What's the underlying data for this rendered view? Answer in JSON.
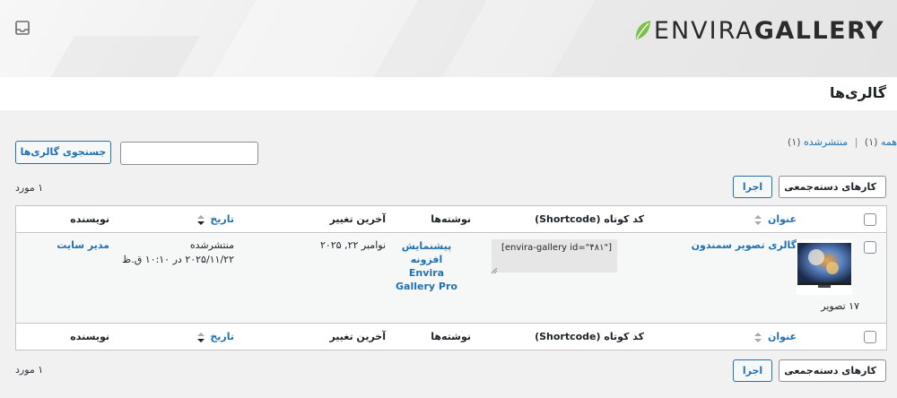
{
  "brand": {
    "name_light": "ENVIRA",
    "name_bold": "GALLERY",
    "accent": "#7cc048"
  },
  "page": {
    "title": "گالری‌ها"
  },
  "filters": {
    "all_label": "همه",
    "all_count": "(۱)",
    "separator": "|",
    "published_label": "منتشرشده",
    "published_count": "(۱)"
  },
  "search": {
    "value": "",
    "button": "جستجوی گالری‌ها"
  },
  "bulk": {
    "selected": "کارهای دسته‌جمعی",
    "apply": "اجرا"
  },
  "items_count": "۱ مورد",
  "table": {
    "columns": {
      "title": "عنوان",
      "shortcode": "کد کوتاه (Shortcode)",
      "posts": "نوشته‌ها",
      "modified": "آخرین تغییر",
      "date": "تاریخ",
      "author": "نویسنده"
    },
    "row": {
      "image_count": "۱۷ تصویر",
      "title": "گالری تصویر سمندون",
      "shortcode": "[envira-gallery id=\"۴۸۱\"]",
      "posts": "پیشنمایش افزونه Envira Gallery Pro",
      "modified": "نوامبر ۲۲, ۲۰۲۵",
      "status": "منتشرشده",
      "date": "۲۰۲۵/۱۱/۲۲ در ۱۰:۱۰ ق.ظ",
      "author": "مدیر سایت"
    }
  },
  "icons": [
    "inbox-icon",
    "leaf-icon",
    "sort-icon",
    "chevron-down-icon",
    "resize-grip-icon"
  ]
}
